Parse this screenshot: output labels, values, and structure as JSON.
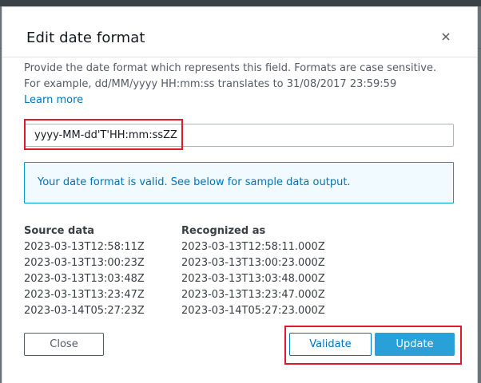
{
  "dialog": {
    "title": "Edit date format",
    "description_line1": "Provide the date format which represents this field. Formats are case sensitive.",
    "description_line2": "For example, dd/MM/yyyy HH:mm:ss translates to 31/08/2017 23:59:59",
    "learn_more": "Learn more",
    "format_value": "yyyy-MM-dd'T'HH:mm:ssZZ",
    "alert_text": "Your date format is valid. See below for sample data output.",
    "close_label": "Close",
    "validate_label": "Validate",
    "update_label": "Update"
  },
  "table": {
    "headers": [
      "Source data",
      "Recognized as"
    ],
    "rows": [
      [
        "2023-03-13T12:58:11Z",
        "2023-03-13T12:58:11.000Z"
      ],
      [
        "2023-03-13T13:00:23Z",
        "2023-03-13T13:00:23.000Z"
      ],
      [
        "2023-03-13T13:03:48Z",
        "2023-03-13T13:03:48.000Z"
      ],
      [
        "2023-03-13T13:23:47Z",
        "2023-03-13T13:23:47.000Z"
      ],
      [
        "2023-03-14T05:27:23Z",
        "2023-03-14T05:27:23.000Z"
      ]
    ]
  },
  "icons": {
    "close": "close-icon"
  },
  "colors": {
    "accent": "#0073bb",
    "primary_button": "#2aa0d9",
    "highlight": "#e0192b",
    "alert_bg": "#f1faff"
  }
}
